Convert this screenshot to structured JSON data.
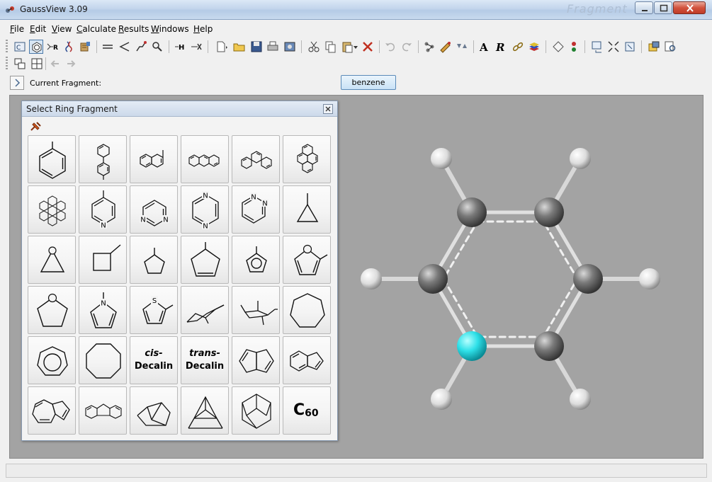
{
  "window": {
    "title": "GaussView 3.09",
    "ghost_title": "Fragment"
  },
  "menu": [
    {
      "mnemonic": "F",
      "rest": "ile"
    },
    {
      "mnemonic": "E",
      "rest": "dit"
    },
    {
      "mnemonic": "V",
      "rest": "iew"
    },
    {
      "mnemonic": "C",
      "rest": "alculate"
    },
    {
      "mnemonic": "R",
      "rest": "esults"
    },
    {
      "mnemonic": "W",
      "rest": "indows"
    },
    {
      "mnemonic": "H",
      "rest": "elp"
    }
  ],
  "fragment_bar": {
    "label": "Current Fragment:",
    "current": "benzene"
  },
  "ring_panel": {
    "title": "Select Ring Fragment",
    "text_cells": {
      "cis_prefix": "cis-",
      "trans_prefix": "trans-",
      "decalin": "Decalin",
      "c60_main": "C",
      "c60_sub": "60"
    },
    "pyrrole_atom": "N",
    "thiophene_atom": "S",
    "pyridine_atom": "N",
    "pyrimidine_atoms": [
      "N",
      "N"
    ],
    "pyrazine_atoms": [
      "N",
      "N"
    ],
    "pyridazine_atoms": [
      "N",
      "N"
    ],
    "oxygen_atom": "O"
  },
  "viewport": {
    "background_color": "#a3a3a3",
    "carbon_color": "#6e6e6e",
    "hydrogen_color": "#f2f2f2",
    "selected_atom_color": "#2ee0e8"
  }
}
